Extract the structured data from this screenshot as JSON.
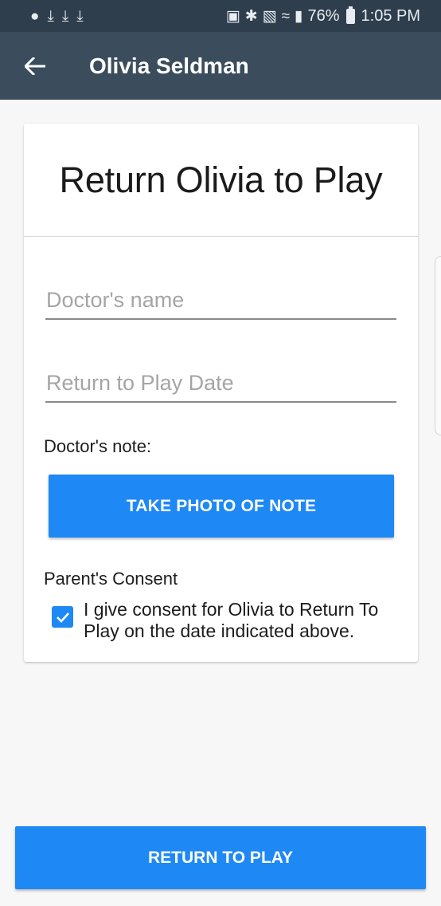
{
  "status_bar": {
    "left_icons": [
      "notification-drop-icon",
      "download-icon",
      "download-icon",
      "download-icon"
    ],
    "battery_percent": "76%",
    "time": "1:05 PM"
  },
  "app_bar": {
    "title": "Olivia Seldman"
  },
  "card": {
    "title": "Return Olivia to Play",
    "doctor_name": {
      "value": "",
      "placeholder": "Doctor's name"
    },
    "return_date": {
      "value": "",
      "placeholder": "Return to Play Date"
    },
    "note_label": "Doctor's note:",
    "photo_button_label": "TAKE PHOTO OF NOTE",
    "consent_label": "Parent's Consent",
    "consent_checked": true,
    "consent_text": "I give consent for Olivia to Return To Play on the date indicated above."
  },
  "return_button_label": "RETURN TO PLAY",
  "colors": {
    "status_bar": "#2e3e4c",
    "app_bar": "#3b4d5c",
    "primary": "#1e88f5",
    "background": "#f7f7f7"
  }
}
